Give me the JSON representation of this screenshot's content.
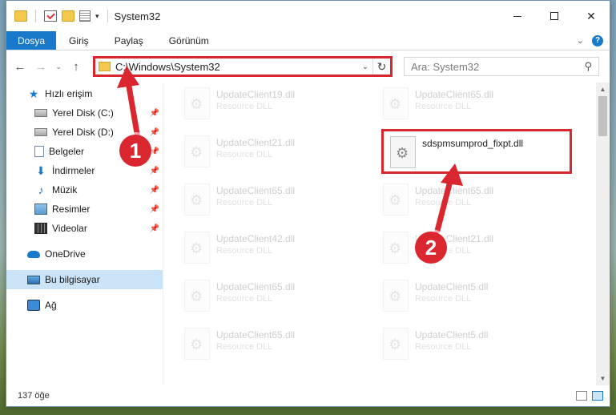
{
  "window": {
    "title": "System32"
  },
  "ribbon": {
    "tabs": [
      {
        "label": "Dosya"
      },
      {
        "label": "Giriş"
      },
      {
        "label": "Paylaş"
      },
      {
        "label": "Görünüm"
      }
    ]
  },
  "address": {
    "path": "C:\\Windows\\System32"
  },
  "search": {
    "placeholder": "Ara: System32"
  },
  "nav": {
    "quick_access": "Hızlı erişim",
    "items": [
      {
        "label": "Yerel Disk (C:)",
        "icon": "disk-icon"
      },
      {
        "label": "Yerel Disk (D:)",
        "icon": "disk-icon"
      },
      {
        "label": "Belgeler",
        "icon": "documents-icon"
      },
      {
        "label": "İndirmeler",
        "icon": "downloads-icon"
      },
      {
        "label": "Müzik",
        "icon": "music-icon"
      },
      {
        "label": "Resimler",
        "icon": "pictures-icon"
      },
      {
        "label": "Videolar",
        "icon": "videos-icon"
      }
    ],
    "onedrive": "OneDrive",
    "this_pc": "Bu bilgisayar",
    "network": "Ağ"
  },
  "files": {
    "left": [
      {
        "name": "UpdateClient19.dll",
        "type": "Resource DLL"
      },
      {
        "name": "UpdateClient21.dll",
        "type": "Resource DLL"
      },
      {
        "name": "UpdateClient65.dll",
        "type": "Resource DLL"
      },
      {
        "name": "UpdateClient42.dll",
        "type": "Resource DLL"
      },
      {
        "name": "UpdateClient65.dll",
        "type": "Resource DLL"
      },
      {
        "name": "UpdateClient65.dll",
        "type": "Resource DLL"
      }
    ],
    "right": [
      {
        "name": "UpdateClient65.dll",
        "type": "Resource DLL"
      },
      {
        "name": "sdspmsumprod_fixpt.dll",
        "type": ""
      },
      {
        "name": "UpdateClient65.dll",
        "type": "Resource DLL"
      },
      {
        "name": "UpdateClient21.dll",
        "type": "Resource DLL"
      },
      {
        "name": "UpdateClient5.dll",
        "type": "Resource DLL"
      },
      {
        "name": "UpdateClient5.dll",
        "type": "Resource DLL"
      }
    ]
  },
  "status": {
    "count": "137 öğe"
  },
  "annotations": {
    "step1": "1",
    "step2": "2"
  },
  "colors": {
    "accent": "#1979ca",
    "highlight": "#d9262f"
  }
}
